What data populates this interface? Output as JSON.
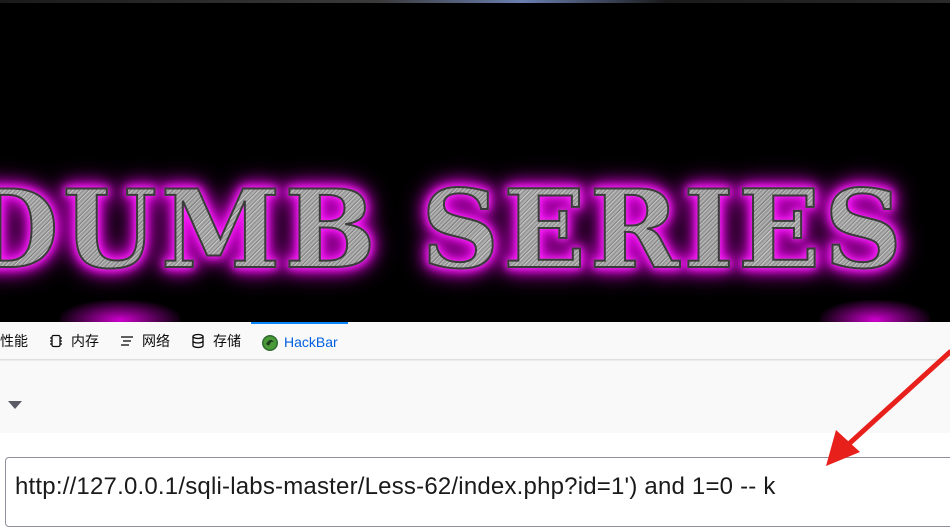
{
  "banner": {
    "text": "DUMB SERIES",
    "colors": {
      "background": "#000000",
      "glow": "#e600e6",
      "metal": "#9a9a9a"
    }
  },
  "devtools": {
    "tabs": [
      {
        "label": "性能",
        "icon": "performance-icon"
      },
      {
        "label": "内存",
        "icon": "memory-chip-icon"
      },
      {
        "label": "网络",
        "icon": "network-icon"
      },
      {
        "label": "存储",
        "icon": "database-icon"
      },
      {
        "label": "HackBar",
        "icon": "hackbar-logo-icon",
        "active": true
      }
    ],
    "active_color": "#0060df"
  },
  "hackbar": {
    "dropdown_icon": "caret-down-icon",
    "url_value": "http://127.0.0.1/sqli-labs-master/Less-62/index.php?id=1') and 1=0 -- k"
  },
  "annotation": {
    "icon": "red-arrow",
    "color": "#e8201c"
  }
}
